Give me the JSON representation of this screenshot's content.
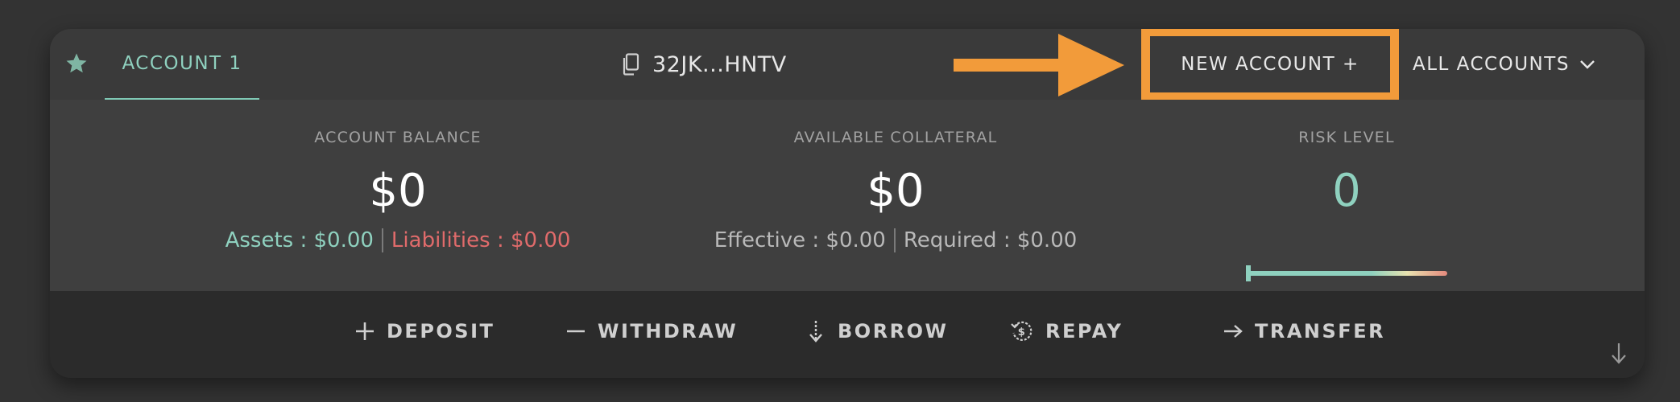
{
  "header": {
    "tab_label": "ACCOUNT 1",
    "address": "32JK...HNTV",
    "new_account_label": "NEW ACCOUNT +",
    "all_accounts_label": "ALL ACCOUNTS"
  },
  "stats": {
    "balance": {
      "label": "ACCOUNT BALANCE",
      "value": "$0",
      "assets": "Assets : $0.00",
      "liabilities": "Liabilities : $0.00"
    },
    "collateral": {
      "label": "AVAILABLE COLLATERAL",
      "value": "$0",
      "effective": "Effective : $0.00",
      "required": "Required : $0.00"
    },
    "risk": {
      "label": "RISK LEVEL",
      "value": "0",
      "level_fraction": 0
    }
  },
  "actions": [
    {
      "label": "DEPOSIT",
      "icon": "plus-icon"
    },
    {
      "label": "WITHDRAW",
      "icon": "minus-icon"
    },
    {
      "label": "BORROW",
      "icon": "arrow-down-icon"
    },
    {
      "label": "REPAY",
      "icon": "repay-icon"
    },
    {
      "label": "TRANSFER",
      "icon": "arrow-right-icon"
    }
  ],
  "colors": {
    "accent_teal": "#8fd1bf",
    "liability_red": "#e06b6b",
    "annotation_orange": "#f29b3a"
  }
}
